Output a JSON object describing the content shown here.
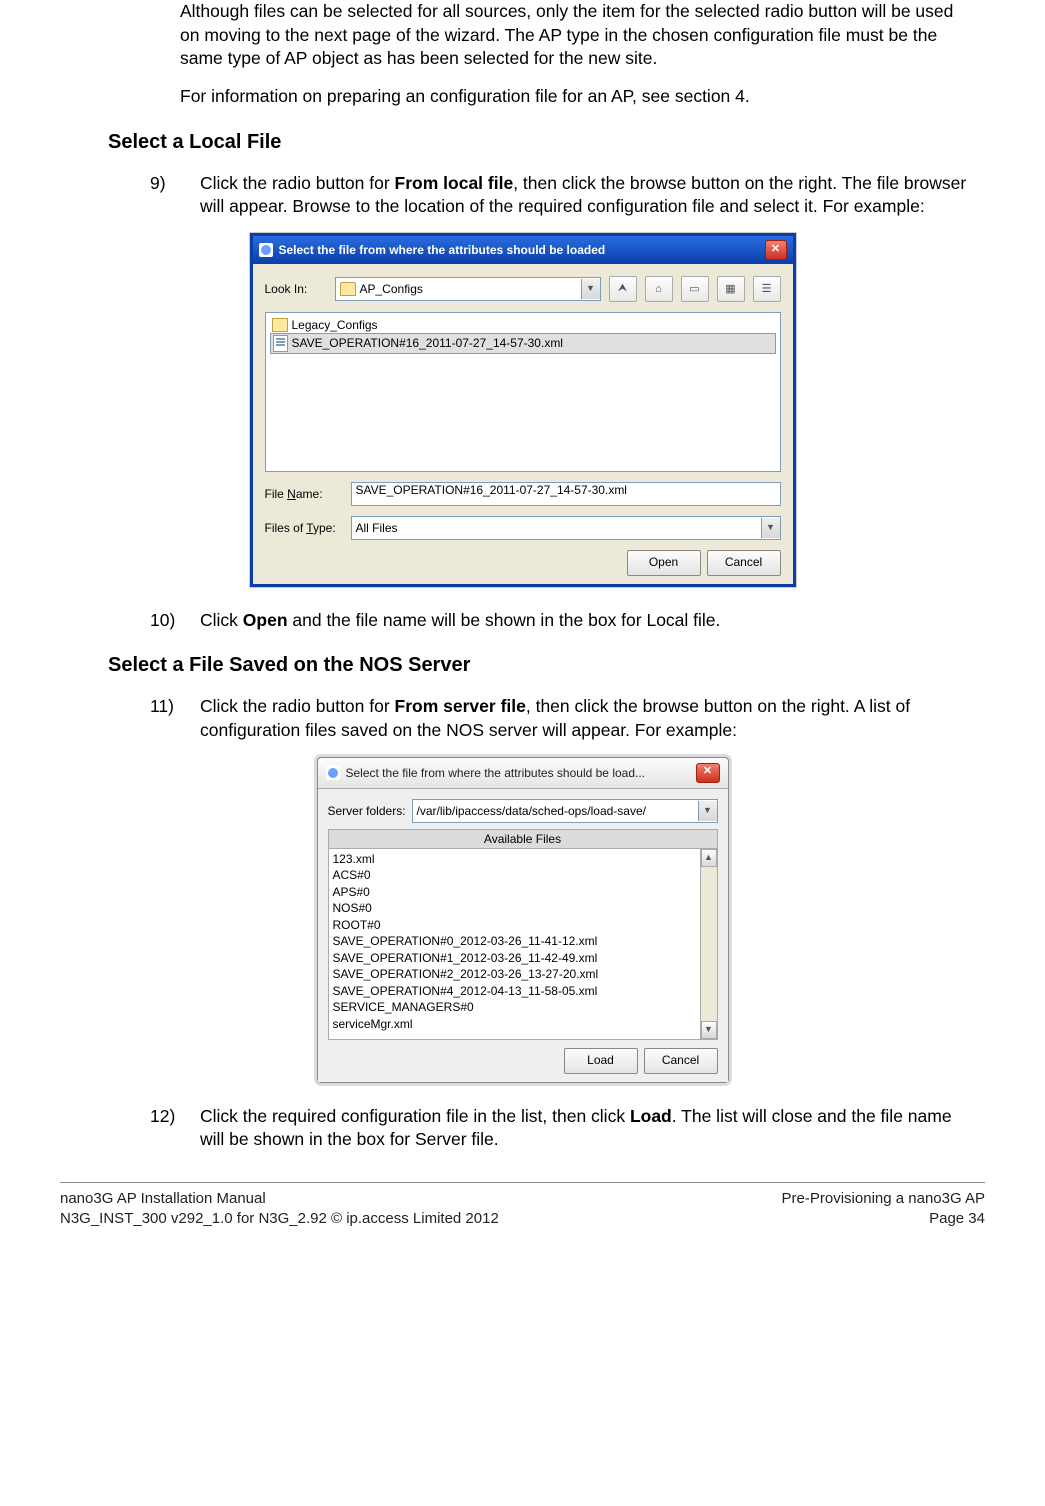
{
  "intro": {
    "p1": "Although files can be selected for all sources, only the item for the selected radio button will be used on moving to the next page of the wizard. The AP type in the chosen configuration file must be the same type of AP object as has been selected for the new site.",
    "p2": "For information on preparing an configuration file for an AP, see section 4."
  },
  "sectionA": {
    "heading": "Select a Local File",
    "step9_num": "9)",
    "step9_a": "Click the radio button for ",
    "step9_bold": "From local file",
    "step9_b": ", then click the browse button on the right. The file browser will appear. Browse to the location of the required configuration file and select it. For example:",
    "step10_num": "10)",
    "step10_a": "Click ",
    "step10_bold": "Open",
    "step10_b": " and the file name will be shown in the box for Local file."
  },
  "dlg1": {
    "title": "Select the file from where the attributes should be loaded",
    "lookin_label": "Look In:",
    "lookin_value": "AP_Configs",
    "items": [
      {
        "type": "folder",
        "name": "Legacy_Configs"
      },
      {
        "type": "file",
        "name": "SAVE_OPERATION#16_2011-07-27_14-57-30.xml"
      }
    ],
    "filename_accel_pre": "File ",
    "filename_accel_u": "N",
    "filename_accel_post": "ame:",
    "filename_value": "SAVE_OPERATION#16_2011-07-27_14-57-30.xml",
    "filetype_accel_pre": "Files of ",
    "filetype_accel_u": "T",
    "filetype_accel_post": "ype:",
    "filetype_value": "All Files",
    "open": "Open",
    "cancel": "Cancel"
  },
  "sectionB": {
    "heading": "Select a File Saved on the NOS Server",
    "step11_num": "11)",
    "step11_a": "Click the radio button for ",
    "step11_bold": "From server file",
    "step11_b": ", then click the browse button on the right. A list of configuration files saved on the NOS server will appear. For example:",
    "step12_num": "12)",
    "step12_a": "Click the required configuration file in the list, then click ",
    "step12_bold": "Load",
    "step12_b": ". The list will close and the file name will be shown in the box for Server file."
  },
  "dlg2": {
    "title": "Select the file from where the attributes should be load...",
    "folders_label": "Server folders:",
    "folders_value": "/var/lib/ipaccess/data/sched-ops/load-save/",
    "available_header": "Available Files",
    "files": [
      "123.xml",
      "ACS#0",
      "APS#0",
      "NOS#0",
      "ROOT#0",
      "SAVE_OPERATION#0_2012-03-26_11-41-12.xml",
      "SAVE_OPERATION#1_2012-03-26_11-42-49.xml",
      "SAVE_OPERATION#2_2012-03-26_13-27-20.xml",
      "SAVE_OPERATION#4_2012-04-13_11-58-05.xml",
      "SERVICE_MANAGERS#0",
      "serviceMgr.xml"
    ],
    "load": "Load",
    "cancel": "Cancel"
  },
  "footer": {
    "left1": "nano3G AP Installation Manual",
    "left2": "N3G_INST_300 v292_1.0 for N3G_2.92 © ip.access Limited 2012",
    "right1": "Pre-Provisioning a nano3G AP",
    "right2": "Page 34"
  }
}
